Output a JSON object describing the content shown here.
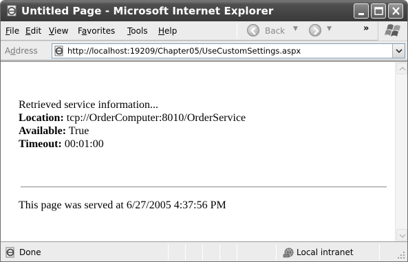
{
  "window": {
    "title": "Untitled Page - Microsoft Internet Explorer"
  },
  "menu": {
    "items": [
      {
        "prefix": "",
        "underline": "F",
        "rest": "ile"
      },
      {
        "prefix": "",
        "underline": "E",
        "rest": "dit"
      },
      {
        "prefix": "",
        "underline": "V",
        "rest": "iew"
      },
      {
        "prefix": "F",
        "underline": "a",
        "rest": "vorites"
      },
      {
        "prefix": "",
        "underline": "T",
        "rest": "ools"
      },
      {
        "prefix": "",
        "underline": "H",
        "rest": "elp"
      }
    ],
    "back_label": "Back",
    "more_glyph": "»"
  },
  "address": {
    "label_prefix": "A",
    "label_underline": "d",
    "label_rest": "dress",
    "url": "http://localhost:19209/Chapter05/UseCustomSettings.aspx"
  },
  "page": {
    "intro": "Retrieved service information...",
    "location_label": "Location:",
    "location_value": " tcp://OrderComputer:8010/OrderService",
    "available_label": "Available:",
    "available_value": " True",
    "timeout_label": "Timeout:",
    "timeout_value": " 00:01:00",
    "served": "This page was served at 6/27/2005 4:37:56 PM"
  },
  "status": {
    "text": "Done",
    "zone": "Local intranet"
  },
  "icons": {
    "title": "ie-page-icon",
    "address": "ie-page-icon",
    "status": "ie-page-icon",
    "zone": "local-intranet-icon"
  }
}
